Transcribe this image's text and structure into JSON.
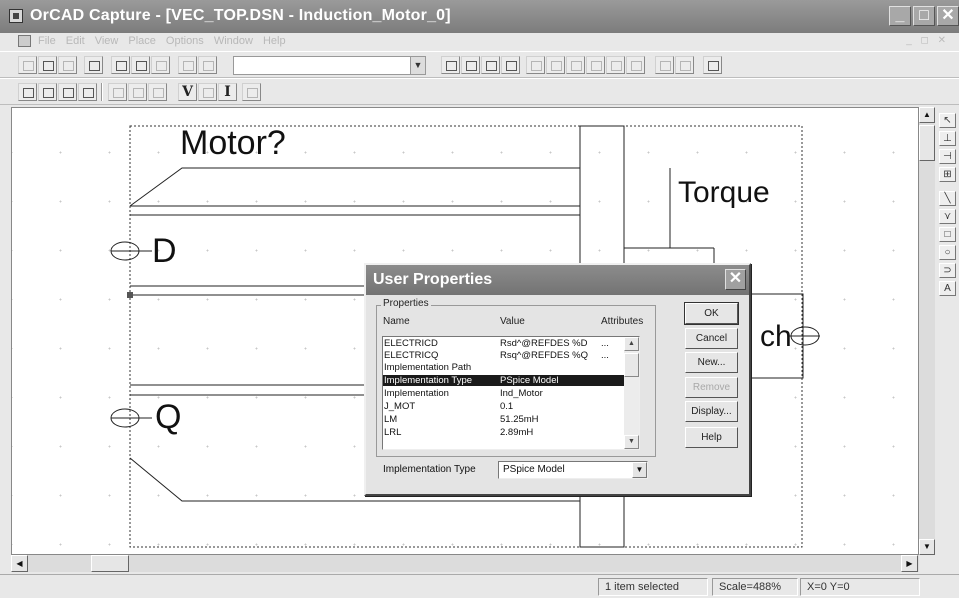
{
  "window": {
    "title": "OrCAD Capture - [VEC_TOP.DSN - Induction_Motor_0]",
    "minimize_glyph": "_",
    "maximize_glyph": "□",
    "close_glyph": "✕"
  },
  "menubar": {
    "items": [
      "File",
      "Edit",
      "View",
      "Place",
      "Options",
      "Window",
      "Help"
    ],
    "mdi_controls": "_ ◻ ✕"
  },
  "toolbar2": {
    "v_label": "V",
    "i_label": "I"
  },
  "schematic": {
    "reference_label": "Motor?",
    "pin_d": "D",
    "pin_q": "Q",
    "torque_label": "Torque",
    "partial_label": "ch"
  },
  "dialog": {
    "title": "User Properties",
    "close_glyph": "✕",
    "group_label": "Properties",
    "columns": [
      "Name",
      "Value",
      "Attributes"
    ],
    "rows": [
      {
        "name": "ELECTRICD",
        "value": "Rsd^@REFDES  %D",
        "attr": "..."
      },
      {
        "name": "ELECTRICQ",
        "value": "Rsq^@REFDES %Q",
        "attr": "..."
      },
      {
        "name": "Implementation Path",
        "value": "",
        "attr": ""
      },
      {
        "name": "Implementation Type",
        "value": "PSpice Model",
        "attr": "",
        "selected": true
      },
      {
        "name": "Implementation",
        "value": "Ind_Motor",
        "attr": ""
      },
      {
        "name": "J_MOT",
        "value": "0.1",
        "attr": ""
      },
      {
        "name": "LM",
        "value": "51.25mH",
        "attr": ""
      },
      {
        "name": "LRL",
        "value": "2.89mH",
        "attr": ""
      }
    ],
    "buttons": {
      "ok": "OK",
      "cancel": "Cancel",
      "new": "New...",
      "remove": "Remove",
      "display": "Display...",
      "help": "Help"
    },
    "bottom_label": "Implementation Type",
    "bottom_value": "PSpice Model"
  },
  "palette": {
    "select_glyph": "↖",
    "text_glyph": "A"
  },
  "statusbar": {
    "selection": "1 item selected",
    "scale": "Scale=488%",
    "coords": "X=0  Y=0"
  }
}
